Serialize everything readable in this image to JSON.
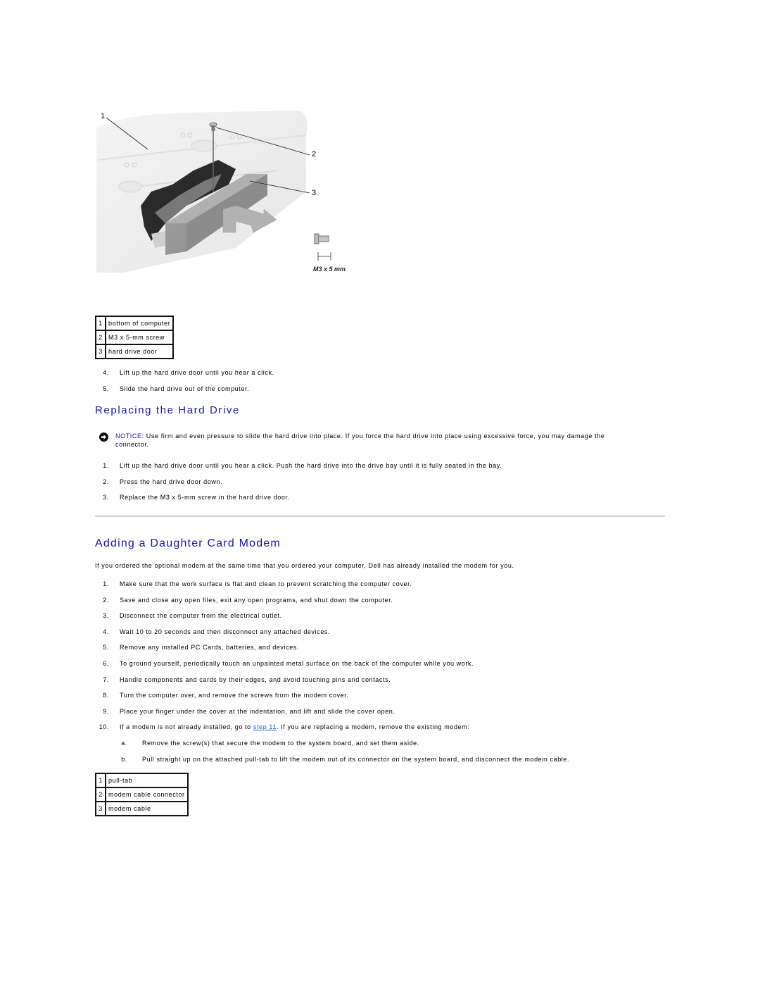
{
  "figure1": {
    "callouts": [
      "1",
      "2",
      "3"
    ],
    "screw_caption": "M3 x 5 mm"
  },
  "legend1": [
    {
      "num": "1",
      "label": "bottom of computer"
    },
    {
      "num": "2",
      "label": "M3 x 5-mm screw"
    },
    {
      "num": "3",
      "label": "hard drive door"
    }
  ],
  "removal_steps": [
    {
      "num": "4.",
      "text": "Lift up the hard drive door until you hear a click."
    },
    {
      "num": "5.",
      "text": "Slide the hard drive out of the computer."
    }
  ],
  "replacing": {
    "heading": "Replacing the Hard Drive",
    "notice": {
      "icon": "notice-arrow-icon",
      "label": "NOTICE:",
      "text_line1": " Use firm and even pressure to slide the hard drive into place. If you force the hard drive into place using excessive force, you may damage the",
      "text_line2": "connector."
    },
    "steps": [
      {
        "num": "1.",
        "text": "Lift up the hard drive door until you hear a click. Push the hard drive into the drive bay until it is fully seated in the bay."
      },
      {
        "num": "2.",
        "text": "Press the hard drive door down."
      },
      {
        "num": "3.",
        "text": "Replace the M3 x 5-mm screw in the hard drive door."
      }
    ]
  },
  "modem": {
    "heading": "Adding a Daughter Card Modem",
    "intro": "If you ordered the optional modem at the same time that you ordered your computer, Dell has already installed the modem for you.",
    "steps": [
      {
        "num": "1.",
        "text": "Make sure that the work surface is flat and clean to prevent scratching the computer cover."
      },
      {
        "num": "2.",
        "text": "Save and close any open files, exit any open programs, and shut down the computer."
      },
      {
        "num": "3.",
        "text": "Disconnect the computer from the electrical outlet."
      },
      {
        "num": "4.",
        "text": "Wait 10 to 20 seconds and then disconnect any attached devices."
      },
      {
        "num": "5.",
        "text": "Remove any installed PC Cards, batteries, and devices."
      },
      {
        "num": "6.",
        "text": "To ground yourself, periodically touch an unpainted metal surface on the back of the computer while you work."
      },
      {
        "num": "7.",
        "text": "Handle components and cards by their edges, and avoid touching pins and contacts."
      },
      {
        "num": "8.",
        "text": "Turn the computer over, and remove the screws from the modem cover."
      },
      {
        "num": "9.",
        "text": "Place your finger under the cover at the indentation, and lift and slide the cover open."
      }
    ],
    "step10": {
      "num": "10.",
      "before": "If a modem is not already installed, go to ",
      "link": "step 11",
      "after": ". If you are replacing a modem, remove the existing modem:"
    },
    "substeps": [
      {
        "num": "a.",
        "text": "Remove the screw(s) that secure the modem to the system board, and set them aside."
      },
      {
        "num": "b.",
        "text": "Pull straight up on the attached pull-tab to lift the modem out of its connector on the system board, and disconnect the modem cable."
      }
    ]
  },
  "legend2": [
    {
      "num": "1",
      "label": "pull-tab"
    },
    {
      "num": "2",
      "label": "modem cable connector"
    },
    {
      "num": "3",
      "label": "modem cable"
    }
  ],
  "colors": {
    "heading": "#1a1aa6",
    "link": "#1a5fd6"
  }
}
